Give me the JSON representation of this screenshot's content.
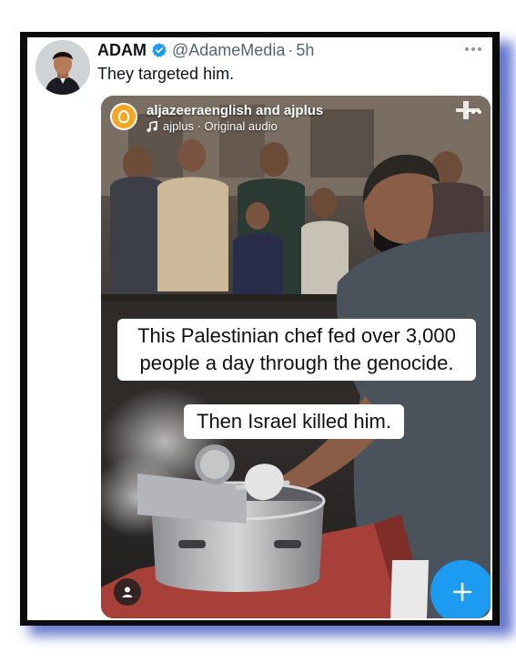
{
  "tweet": {
    "author_name": "ADAM",
    "handle": "@AdameMedia",
    "separator": "·",
    "time": "5h",
    "text": "They targeted him."
  },
  "reel": {
    "accounts": "aljazeeraenglish and ajplus",
    "audio": "ajplus · Original audio"
  },
  "captions": [
    "This Palestinian chef fed over 3,000 people a day through the genocide.",
    "Then Israel killed him."
  ],
  "colors": {
    "verified": "#1d9bf0",
    "muted_text": "#536471",
    "frame": "#0b0b0b",
    "frame_shadow": "#4b5fc4",
    "fab": "#1d9bf0"
  },
  "icons": {
    "verified": "verified-badge-icon",
    "more": "more-options-icon",
    "music": "music-note-icon",
    "profile": "person-icon",
    "compose": "compose-plus-icon"
  }
}
